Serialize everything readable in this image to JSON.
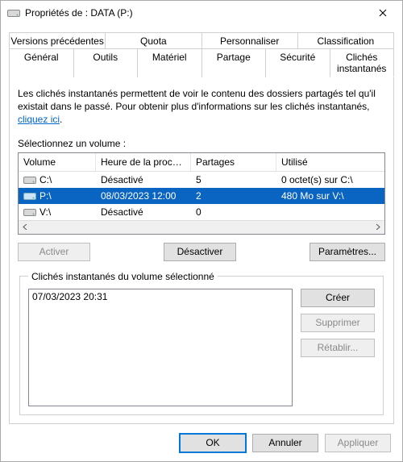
{
  "window": {
    "title": "Propriétés de : DATA (P:)"
  },
  "tabs": {
    "row1": [
      "Versions précédentes",
      "Quota",
      "Personnaliser",
      "Classification"
    ],
    "row2": [
      "Général",
      "Outils",
      "Matériel",
      "Partage",
      "Sécurité",
      "Clichés instantanés"
    ],
    "active": "Clichés instantanés"
  },
  "panel": {
    "intro_pre": "Les clichés instantanés permettent de voir le contenu des dossiers partagés tel qu'il existait dans le passé. Pour obtenir plus d'informations sur les clichés instantanés, ",
    "intro_link": "cliquez ici",
    "intro_post": ".",
    "select_label": "Sélectionnez un volume :",
    "columns": {
      "volume": "Volume",
      "time": "Heure de la procha...",
      "shares": "Partages",
      "used": "Utilisé"
    },
    "volumes": [
      {
        "name": "C:\\",
        "time": "Désactivé",
        "shares": "5",
        "used": "0 octet(s) sur C:\\",
        "selected": false
      },
      {
        "name": "P:\\",
        "time": "08/03/2023 12:00",
        "shares": "2",
        "used": "480 Mo sur V:\\",
        "selected": true
      },
      {
        "name": "V:\\",
        "time": "Désactivé",
        "shares": "0",
        "used": "",
        "selected": false
      }
    ],
    "buttons": {
      "enable": "Activer",
      "disable": "Désactiver",
      "settings": "Paramètres..."
    },
    "group_title": "Clichés instantanés du volume sélectionné",
    "snapshots": [
      "07/03/2023 20:31"
    ],
    "snap_buttons": {
      "create": "Créer",
      "delete": "Supprimer",
      "restore": "Rétablir..."
    }
  },
  "footer": {
    "ok": "OK",
    "cancel": "Annuler",
    "apply": "Appliquer"
  }
}
